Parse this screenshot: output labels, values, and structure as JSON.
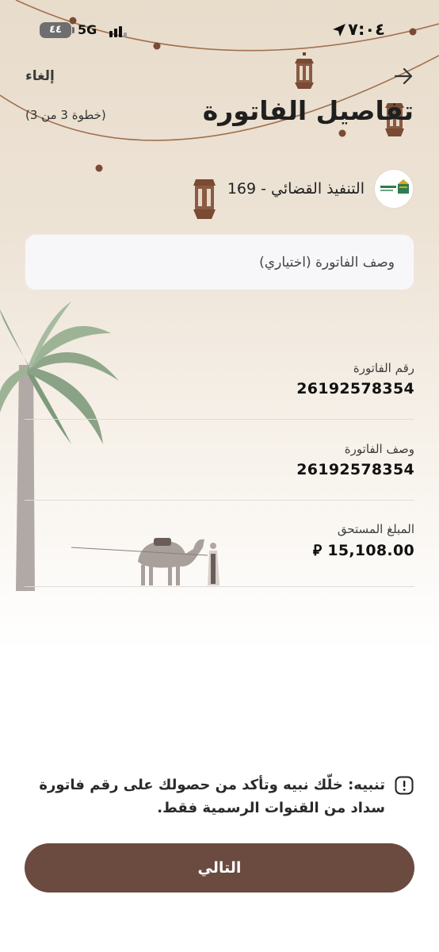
{
  "status_bar": {
    "battery": "٤٤",
    "network": "5G",
    "time": "٧:٠٤"
  },
  "header": {
    "cancel_label": "إلغاء",
    "title": "تفاصيل الفاتورة",
    "step": "(خطوة 3 من 3)",
    "back_icon": "arrow-right-icon"
  },
  "biller": {
    "name": "169 - التنفيذ القضائي",
    "logo_icon": "ministry-of-justice-logo"
  },
  "description_input": {
    "value": "",
    "placeholder": "وصف الفاتورة (اختياري)"
  },
  "details": [
    {
      "label": "رقم الفاتورة",
      "value": "26192578354"
    },
    {
      "label": "وصف الفاتورة",
      "value": "26192578354"
    },
    {
      "label": "المبلغ المستحق",
      "value": "⃁ 15,108.00"
    }
  ],
  "warning": {
    "icon": "exclamation-icon",
    "text": "تنبيه: خلّك نبيه وتأكد من حصولك على رقم فاتورة سداد من القنوات الرسمية فقط."
  },
  "next_button": {
    "label": "التالي"
  },
  "colors": {
    "accent": "#6b4a40",
    "background_top": "#e8dccb",
    "text": "#222222"
  }
}
